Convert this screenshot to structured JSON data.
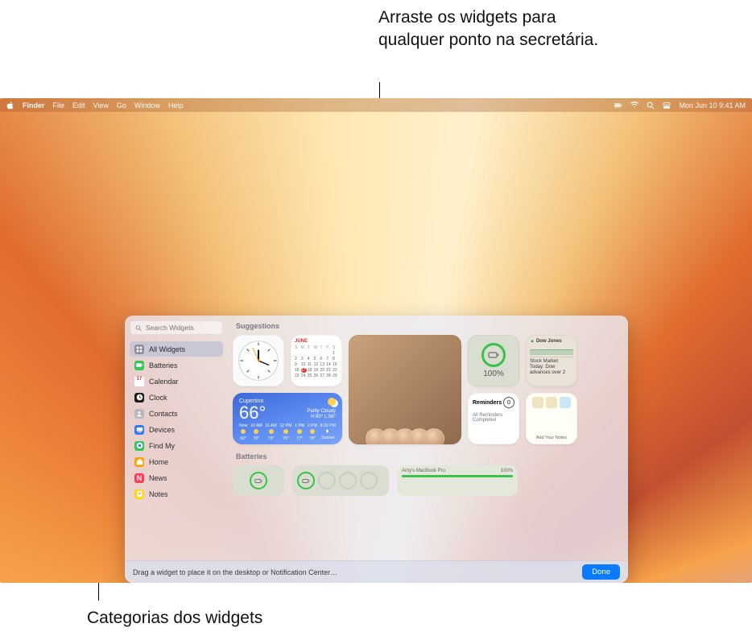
{
  "callouts": {
    "drag": "Arraste os widgets para qualquer ponto na secretária.",
    "categories": "Categorias dos widgets"
  },
  "menubar": {
    "app": "Finder",
    "items": [
      "File",
      "Edit",
      "View",
      "Go",
      "Window",
      "Help"
    ],
    "datetime": "Mon Jun 10  9:41 AM"
  },
  "gallery": {
    "search_placeholder": "Search Widgets",
    "categories": [
      {
        "label": "All Widgets",
        "icon": "grid",
        "color": "#8e8e98",
        "selected": true
      },
      {
        "label": "Batteries",
        "icon": "battery",
        "color": "#34c759"
      },
      {
        "label": "Calendar",
        "icon": "calendar",
        "color": "#ffffff"
      },
      {
        "label": "Clock",
        "icon": "clock",
        "color": "#1c1c1e"
      },
      {
        "label": "Contacts",
        "icon": "contacts",
        "color": "#b7b7c0"
      },
      {
        "label": "Devices",
        "icon": "devices",
        "color": "#3478f6"
      },
      {
        "label": "Find My",
        "icon": "findmy",
        "color": "#34c759"
      },
      {
        "label": "Home",
        "icon": "home",
        "color": "#ff9f0a"
      },
      {
        "label": "News",
        "icon": "news",
        "color": "#ff3b55"
      },
      {
        "label": "Notes",
        "icon": "notes",
        "color": "#ffd60a"
      }
    ],
    "sections": {
      "suggestions": "Suggestions",
      "batteries": "Batteries"
    },
    "footer_hint": "Drag a widget to place it on the desktop or Notification Center…",
    "done": "Done"
  },
  "widgets": {
    "calendar": {
      "month": "June",
      "day": "17"
    },
    "weather": {
      "city": "Cupertino",
      "temp": "66°",
      "cond": "Partly Cloudy",
      "hilo": "H:80° L:56°",
      "hours": [
        {
          "t": "Now",
          "v": "66°",
          "k": "sun"
        },
        {
          "t": "10 AM",
          "v": "70°",
          "k": "sun"
        },
        {
          "t": "11 AM",
          "v": "73°",
          "k": "sun"
        },
        {
          "t": "12 PM",
          "v": "75°",
          "k": "sun"
        },
        {
          "t": "1 PM",
          "v": "77°",
          "k": "sun"
        },
        {
          "t": "2 PM",
          "v": "78°",
          "k": "sun"
        },
        {
          "t": "8:32 PM",
          "v": "Sunset",
          "k": "moon"
        }
      ]
    },
    "battery": {
      "pct": "100%"
    },
    "stocks": {
      "symbol": "Dow Jones",
      "line1": "Stock Market Today: Dow advances over 2"
    },
    "reminders": {
      "title": "Reminders",
      "count": "0",
      "body": "All Reminders Completed"
    },
    "notes": {
      "label": "Add Your Notes"
    },
    "battery_wide": {
      "name": "Amy's MacBook Pro",
      "pct": "100%"
    }
  }
}
